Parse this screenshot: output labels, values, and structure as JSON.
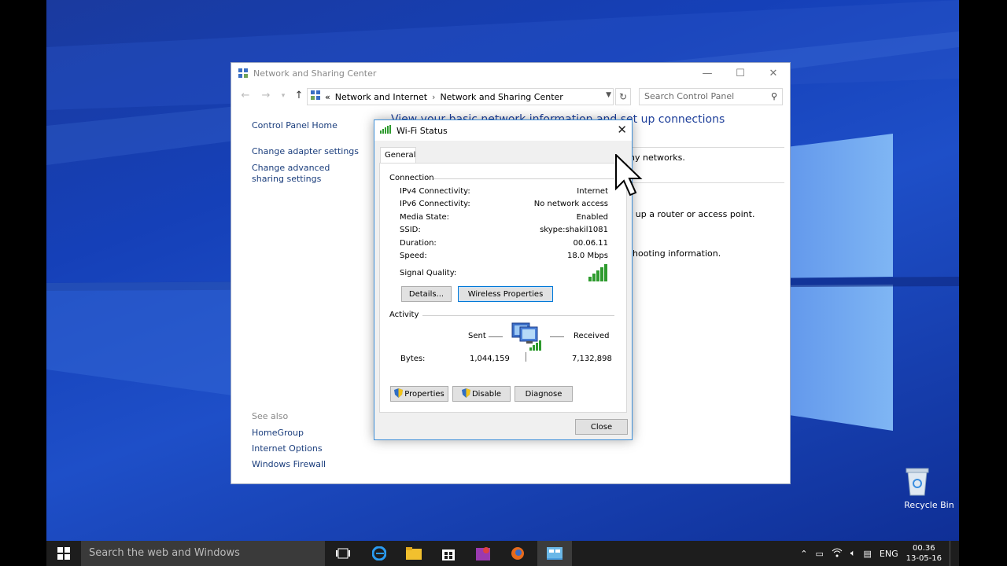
{
  "window": {
    "title": "Network and Sharing Center",
    "minimize": "—",
    "maximize": "☐",
    "close": "✕"
  },
  "address": {
    "prefix": "«",
    "crumb1": "Network and Internet",
    "separator": "›",
    "crumb2": "Network and Sharing Center",
    "search_placeholder": "Search Control Panel"
  },
  "left_nav": {
    "home": "Control Panel Home",
    "adapter": "Change adapter settings",
    "advanced": "Change advanced sharing settings",
    "see_also_label": "See also",
    "homegroup": "HomeGroup",
    "internet_options": "Internet Options",
    "firewall": "Windows Firewall"
  },
  "content": {
    "heading": "View your basic network information and set up connections",
    "line1": "ny networks.",
    "line2": "t up a router or access point.",
    "line3": "hooting information."
  },
  "dialog": {
    "title": "Wi-Fi Status",
    "close_glyph": "✕",
    "tab": "General",
    "connection_label": "Connection",
    "rows": [
      {
        "label": "IPv4 Connectivity:",
        "value": "Internet"
      },
      {
        "label": "IPv6 Connectivity:",
        "value": "No network access"
      },
      {
        "label": "Media State:",
        "value": "Enabled"
      },
      {
        "label": "SSID:",
        "value": "skype:shakil1081"
      },
      {
        "label": "Duration:",
        "value": "00.06.11"
      },
      {
        "label": "Speed:",
        "value": "18.0 Mbps"
      }
    ],
    "signal_label": "Signal Quality:",
    "signal_bars": 5,
    "details_btn": "Details...",
    "wireless_props_btn": "Wireless Properties",
    "activity_label": "Activity",
    "sent_label": "Sent",
    "received_label": "Received",
    "bytes_label": "Bytes:",
    "bytes_sent": "1,044,159",
    "bytes_received": "7,132,898",
    "properties_btn": "Properties",
    "disable_btn": "Disable",
    "diagnose_btn": "Diagnose",
    "close_btn": "Close"
  },
  "desktop": {
    "recycle_bin": "Recycle Bin"
  },
  "taskbar": {
    "search_placeholder": "Search the web and Windows",
    "language": "ENG",
    "time": "00.36",
    "date": "13-05-16"
  },
  "colors": {
    "accent": "#0078d7",
    "link": "#1a3d7c",
    "heading": "#1e3f9a",
    "signal_green": "#2e9b2e"
  }
}
